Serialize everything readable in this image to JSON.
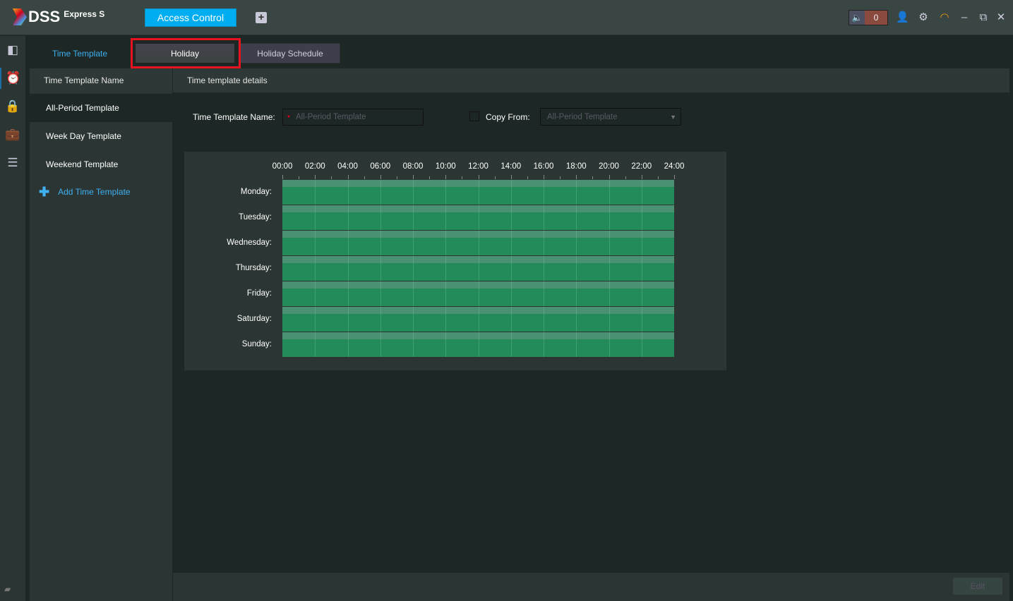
{
  "app": {
    "logo_main": "DSS",
    "logo_sub": "Express S",
    "active_app_tab": "Access Control",
    "alarm_count": "0"
  },
  "tabs": [
    {
      "label": "Time Template"
    },
    {
      "label": "Holiday"
    },
    {
      "label": "Holiday Schedule"
    }
  ],
  "left_panel": {
    "header": "Time Template Name",
    "items": [
      {
        "label": "All-Period Template"
      },
      {
        "label": "Week Day Template"
      },
      {
        "label": "Weekend Template"
      }
    ],
    "add_label": "Add Time Template"
  },
  "details": {
    "header": "Time template details",
    "name_label": "Time Template Name:",
    "name_placeholder": "All-Period Template",
    "copy_label": "Copy From:",
    "copy_value": "All-Period Template"
  },
  "schedule": {
    "hours": [
      "00:00",
      "02:00",
      "04:00",
      "06:00",
      "08:00",
      "10:00",
      "12:00",
      "14:00",
      "16:00",
      "18:00",
      "20:00",
      "22:00",
      "24:00"
    ],
    "days": [
      {
        "label": "Monday:",
        "start": 0,
        "end": 24
      },
      {
        "label": "Tuesday:",
        "start": 0,
        "end": 24
      },
      {
        "label": "Wednesday:",
        "start": 0,
        "end": 24
      },
      {
        "label": "Thursday:",
        "start": 0,
        "end": 24
      },
      {
        "label": "Friday:",
        "start": 0,
        "end": 24
      },
      {
        "label": "Saturday:",
        "start": 0,
        "end": 24
      },
      {
        "label": "Sunday:",
        "start": 0,
        "end": 24
      }
    ],
    "color": "#238a5a"
  },
  "footer": {
    "edit_label": "Edit"
  }
}
